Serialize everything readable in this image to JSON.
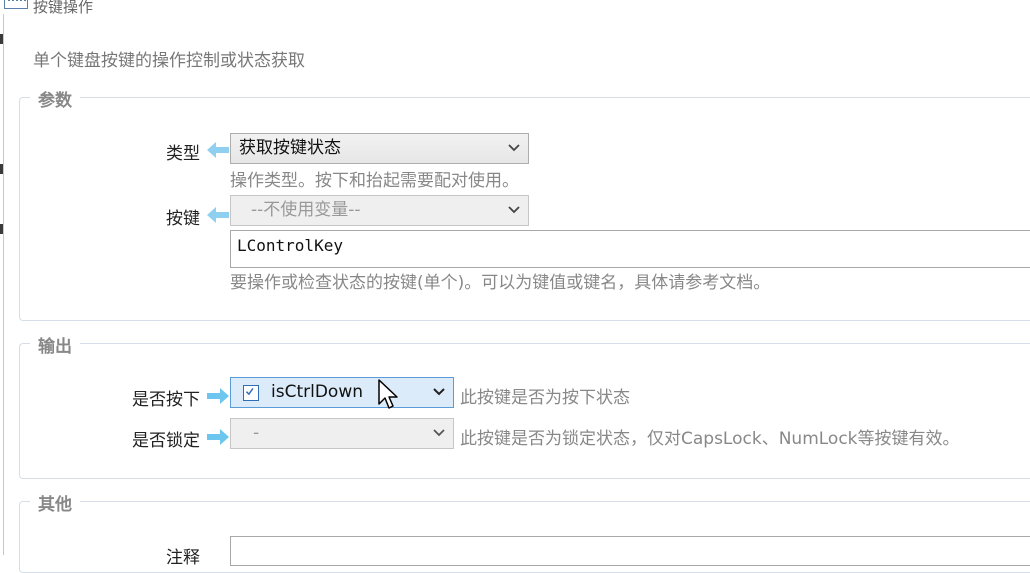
{
  "window": {
    "title": "按键操作"
  },
  "description": "单个键盘按键的操作控制或状态获取",
  "params": {
    "legend": "参数",
    "type": {
      "label": "类型",
      "value": "获取按键状态",
      "hint": "操作类型。按下和抬起需要配对使用。"
    },
    "key": {
      "label": "按键",
      "variable": "--不使用变量--",
      "value": "LControlKey",
      "hint": "要操作或检查状态的按键(单个)。可以为键值或键名，具体请参考文档。"
    }
  },
  "output": {
    "legend": "输出",
    "is_down": {
      "label": "是否按下",
      "value": "isCtrlDown",
      "hint": "此按键是否为按下状态"
    },
    "is_locked": {
      "label": "是否锁定",
      "value": "-",
      "hint": "此按键是否为锁定状态，仅对CapsLock、NumLock等按键有效。"
    }
  },
  "other": {
    "legend": "其他",
    "note": {
      "label": "注释"
    }
  },
  "colors": {
    "input_arrow": "#8fd0f0",
    "output_arrow": "#6cc6ee",
    "active_select": "#dcebf9"
  },
  "icons": [
    "keyboard-icon",
    "arrow-left-icon",
    "arrow-right-icon",
    "chevron-down-icon",
    "checkbox-icon",
    "mouse-cursor-icon"
  ]
}
